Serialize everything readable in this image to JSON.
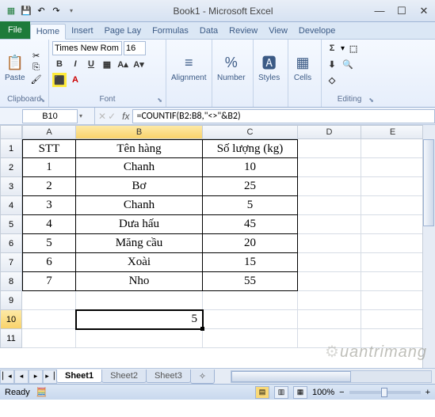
{
  "window": {
    "title": "Book1 - Microsoft Excel"
  },
  "qat": {
    "save": "💾",
    "undo": "↶",
    "redo": "↷",
    "dropdown": "▾"
  },
  "tabs": {
    "file": "File",
    "items": [
      "Home",
      "Insert",
      "Page Lay",
      "Formulas",
      "Data",
      "Review",
      "View",
      "Develope"
    ],
    "active": 0
  },
  "ribbon": {
    "clipboard": {
      "label": "Clipboard",
      "paste": "Paste"
    },
    "font": {
      "label": "Font",
      "name": "Times New Rom",
      "size": "16",
      "bold": "B",
      "italic": "I",
      "underline": "U",
      "grow": "A▴",
      "shrink": "A▾"
    },
    "alignment": {
      "label": "Alignment",
      "btn": "Alignment"
    },
    "number": {
      "label": "Number",
      "btn": "Number",
      "sym": "%"
    },
    "styles": {
      "label": "Styles",
      "btn": "Styles"
    },
    "cells": {
      "label": "Cells",
      "btn": "Cells"
    },
    "editing": {
      "label": "Editing",
      "sigma": "Σ",
      "fill": "⬇",
      "clear": "◇"
    }
  },
  "namebox": "B10",
  "formula": "=COUNTIF(B2:B8,\"<>\"&B2)",
  "columns": [
    "A",
    "B",
    "C",
    "D",
    "E"
  ],
  "rowNums": [
    "1",
    "2",
    "3",
    "4",
    "5",
    "6",
    "7",
    "8",
    "9",
    "10",
    "11"
  ],
  "header": {
    "a": "STT",
    "b": "Tên hàng",
    "c": "Số lượng (kg)"
  },
  "dataRows": [
    {
      "a": "1",
      "b": "Chanh",
      "c": "10"
    },
    {
      "a": "2",
      "b": "Bơ",
      "c": "25"
    },
    {
      "a": "3",
      "b": "Chanh",
      "c": "5"
    },
    {
      "a": "4",
      "b": "Dưa hấu",
      "c": "45"
    },
    {
      "a": "5",
      "b": "Măng cầu",
      "c": "20"
    },
    {
      "a": "6",
      "b": "Xoài",
      "c": "15"
    },
    {
      "a": "7",
      "b": "Nho",
      "c": "55"
    }
  ],
  "activeCell": {
    "value": "5"
  },
  "sheets": {
    "nav": [
      "▏◂",
      "◂",
      "▸",
      "▸▕"
    ],
    "tabs": [
      "Sheet1",
      "Sheet2",
      "Sheet3"
    ],
    "new": "✧",
    "active": 0
  },
  "status": {
    "ready": "Ready",
    "calc": "🧮",
    "zoom": "100%",
    "minus": "−",
    "plus": "+"
  },
  "watermark": "uantrimang"
}
